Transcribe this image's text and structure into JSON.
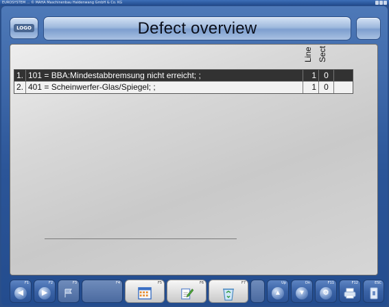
{
  "window": {
    "title": "EUROSYSTEM ... © MAHA Maschinenbau Haldenwang GmbH & Co. KG"
  },
  "header": {
    "logo": "LOGO",
    "title": "Defect overview"
  },
  "table": {
    "columns": {
      "line": "Line",
      "sect": "Sect"
    },
    "rows": [
      {
        "num": "1.",
        "text": "101 = BBA:Mindestabbremsung nicht erreicht; ;",
        "line": "1",
        "sect": "0",
        "selected": true
      },
      {
        "num": "2.",
        "text": "401 = Scheinwerfer-Glas/Spiegel; ;",
        "line": "1",
        "sect": "0",
        "selected": false
      }
    ]
  },
  "toolbar": {
    "keys": [
      {
        "label": "F1",
        "icon": "arrow-left-icon"
      },
      {
        "label": "F2",
        "icon": "arrow-right-icon"
      },
      {
        "label": "F3",
        "icon": "flag-icon"
      },
      {
        "label": "F4",
        "icon": ""
      },
      {
        "label": "F5",
        "icon": "calendar-grid-icon"
      },
      {
        "label": "F6",
        "icon": "edit-note-icon"
      },
      {
        "label": "F7",
        "icon": "recycle-bin-icon"
      },
      {
        "label": "",
        "icon": ""
      },
      {
        "label": "Up",
        "icon": "up-arrow-icon"
      },
      {
        "label": "Dn",
        "icon": "down-arrow-icon"
      },
      {
        "label": "F11",
        "icon": "gear-icon"
      },
      {
        "label": "F12",
        "icon": "print-icon"
      },
      {
        "label": "ESC",
        "icon": "exit-icon"
      }
    ]
  },
  "colors": {
    "frame": "#2b5598",
    "selected_row": "#323232",
    "panel": "#d4d4d4"
  }
}
